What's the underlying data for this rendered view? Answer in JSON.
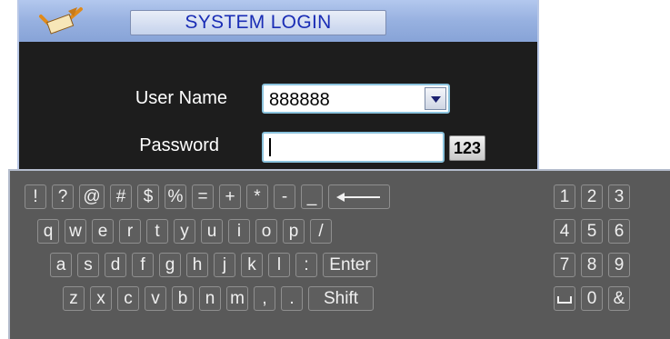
{
  "window": {
    "title": "SYSTEM LOGIN"
  },
  "form": {
    "username_label": "User Name",
    "username_value": "888888",
    "password_label": "Password",
    "password_value": "",
    "input_mode_label": "123"
  },
  "keyboard": {
    "row1": [
      "!",
      "?",
      "@",
      "#",
      "$",
      "%",
      "=",
      "+",
      "*",
      "-",
      "_",
      "⟵"
    ],
    "row2": [
      "q",
      "w",
      "e",
      "r",
      "t",
      "y",
      "u",
      "i",
      "o",
      "p",
      "/"
    ],
    "row3": [
      "a",
      "s",
      "d",
      "f",
      "g",
      "h",
      "j",
      "k",
      "l",
      ":",
      "Enter"
    ],
    "row4": [
      "z",
      "x",
      "c",
      "v",
      "b",
      "n",
      "m",
      ",",
      ".",
      "Shift"
    ],
    "numpad": [
      "1",
      "2",
      "3",
      "4",
      "5",
      "6",
      "7",
      "8",
      "9",
      "␣",
      "0",
      "&"
    ]
  },
  "colors": {
    "title_text": "#1a2db5",
    "title_bar": "#97b1e0",
    "panel_bg": "#1d1d1d",
    "keyboard_bg": "#595959",
    "field_border": "#8cc4de"
  },
  "icons": {
    "logo": "pencil-check-icon",
    "dropdown": "triangle-down-icon",
    "backspace": "long-left-arrow-icon",
    "space": "space-bar-icon"
  }
}
